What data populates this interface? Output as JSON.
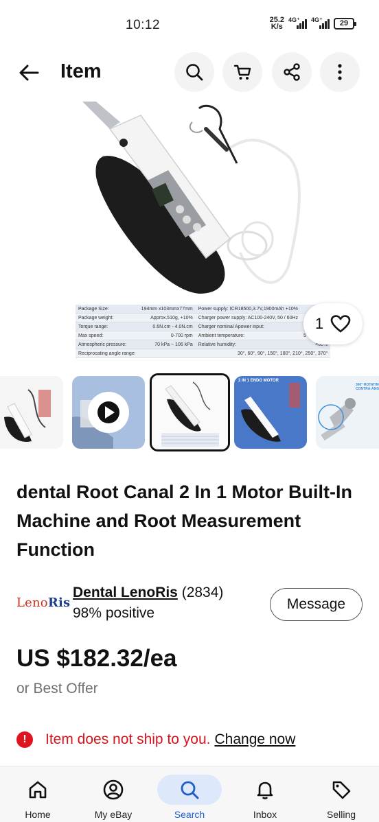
{
  "status_bar": {
    "time": "10:12",
    "net_speed_value": "25.2",
    "net_speed_unit": "K/s",
    "signal_1_label": "4G⁺",
    "signal_2_label": "4G⁺",
    "battery": "29"
  },
  "header": {
    "title": "Item"
  },
  "hero": {
    "watch_count": "1",
    "spec_table": [
      [
        "Package Size:",
        "194mm x103mmx77mm",
        "Power supply: ICR18500,3.7V,1900mAh +10%",
        ""
      ],
      [
        "Package weight:",
        "Approx.510g, +10%",
        "Charger power supply: AC100-240V, 50 / 60Hz",
        ""
      ],
      [
        "Torque range:",
        "0.6N.cm - 4.0N.cm",
        "Charger nominal Apower input:",
        "5V"
      ],
      [
        "Max speed:",
        "0-700 rpm",
        "Ambient temperature:",
        "5°C ~ 40°C"
      ],
      [
        "Atmospheric pressure:",
        "70 kPa ~ 106 kPa",
        "Relative humidity:",
        "<80%"
      ],
      [
        "Reciprocating angle range:",
        "30°, 60°, 90°, 150°, 180°, 210°, 250°, 370°",
        "",
        ""
      ]
    ]
  },
  "thumbnails": {
    "thumb4_caption": "2 IN 1 ENDO MOTOR",
    "thumb5_caption": "360° ROTATING CONTRA-ANGLE"
  },
  "item": {
    "title": "dental Root Canal 2 In 1 Motor Built-In Machine and Root Measurement Function",
    "price": "US $182.32/ea",
    "best_offer": "or Best Offer"
  },
  "seller": {
    "logo_prefix": "Leno",
    "logo_suffix": "Ris",
    "name": "Dental LenoRis",
    "feedback_count": "(2834)",
    "positive": "98% positive",
    "message_label": "Message"
  },
  "shipping": {
    "notice": "Item does not ship to you.",
    "change_link": "Change now"
  },
  "bottom_nav": {
    "items": [
      {
        "label": "Home",
        "icon": "home-icon"
      },
      {
        "label": "My eBay",
        "icon": "account-icon"
      },
      {
        "label": "Search",
        "icon": "search-icon"
      },
      {
        "label": "Inbox",
        "icon": "bell-icon"
      },
      {
        "label": "Selling",
        "icon": "tag-icon"
      }
    ],
    "active_index": 2
  },
  "colors": {
    "accent_blue": "#1f5ccc",
    "alert_red": "#d5141e",
    "nav_active_bg": "#dde8fb"
  }
}
